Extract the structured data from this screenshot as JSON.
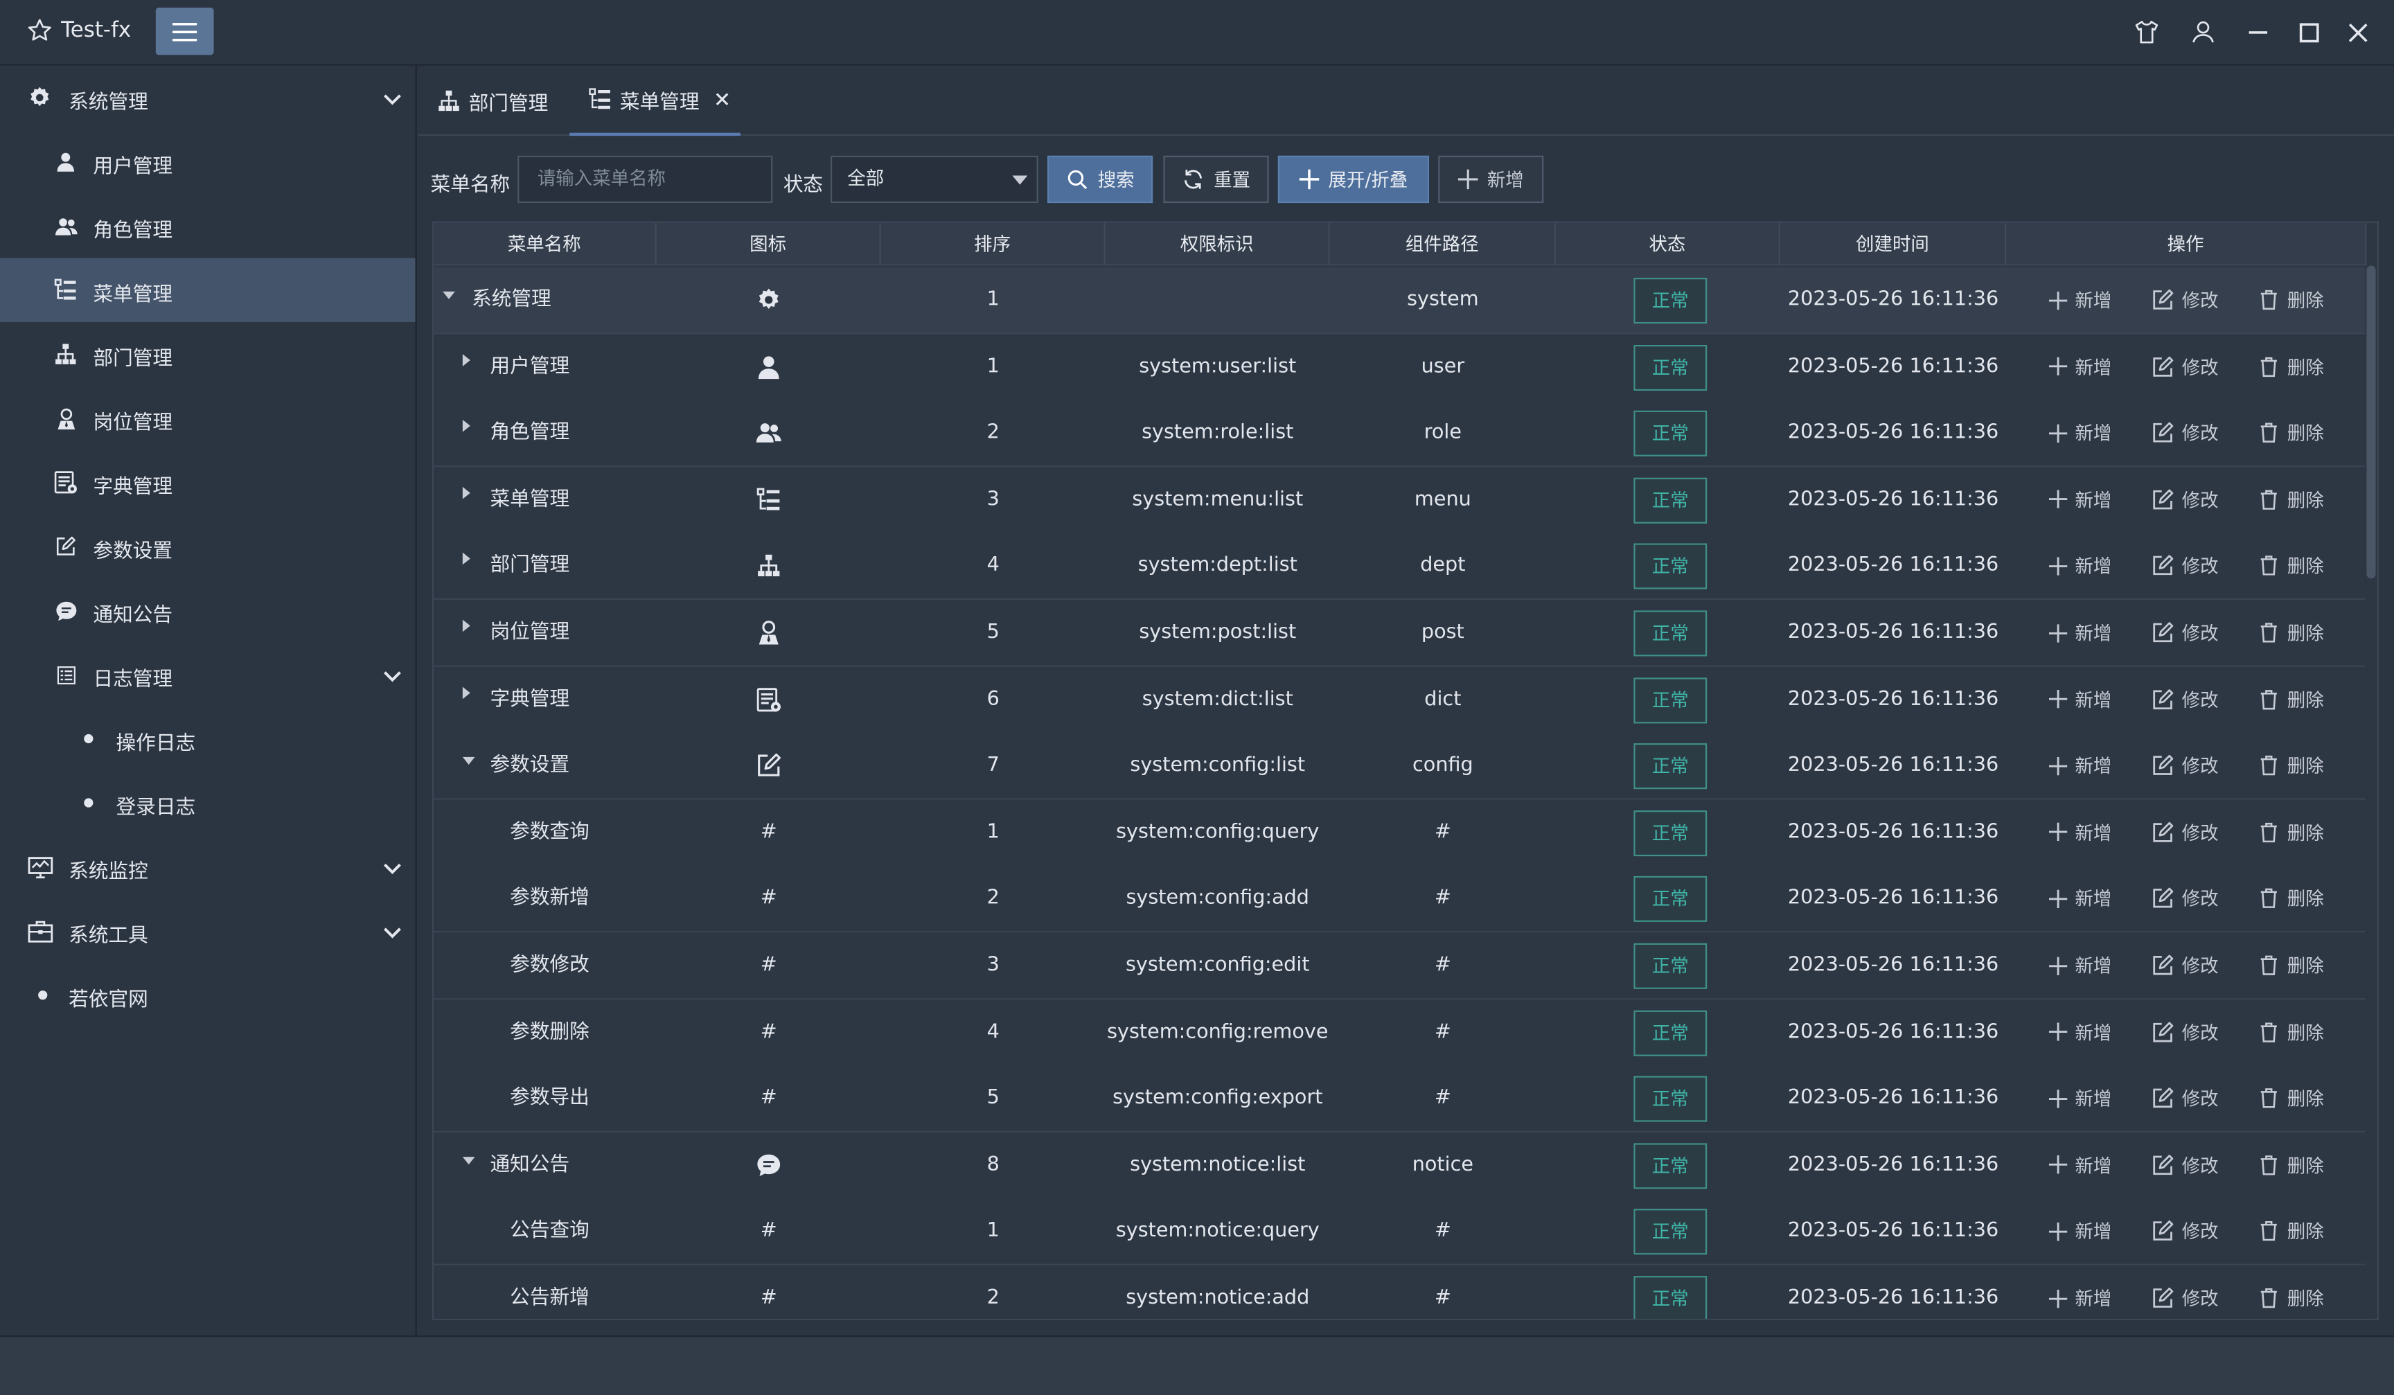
{
  "window": {
    "title": "Test-fx"
  },
  "sidebar": {
    "items": [
      {
        "label": "系统管理",
        "icon": "gear-icon"
      },
      {
        "label": "用户管理",
        "icon": "user-icon"
      },
      {
        "label": "角色管理",
        "icon": "users-icon"
      },
      {
        "label": "菜单管理",
        "icon": "menu-tree-icon"
      },
      {
        "label": "部门管理",
        "icon": "org-chart-icon"
      },
      {
        "label": "岗位管理",
        "icon": "post-icon"
      },
      {
        "label": "字典管理",
        "icon": "dict-icon"
      },
      {
        "label": "参数设置",
        "icon": "edit-icon"
      },
      {
        "label": "通知公告",
        "icon": "chat-icon"
      },
      {
        "label": "日志管理",
        "icon": "log-icon"
      },
      {
        "label": "操作日志",
        "icon": "dot-icon"
      },
      {
        "label": "登录日志",
        "icon": "dot-icon"
      },
      {
        "label": "系统监控",
        "icon": "monitor-icon"
      },
      {
        "label": "系统工具",
        "icon": "toolbox-icon"
      },
      {
        "label": "若依官网",
        "icon": "dot-icon"
      }
    ]
  },
  "tabs": [
    {
      "label": "部门管理"
    },
    {
      "label": "菜单管理"
    }
  ],
  "search": {
    "name_label": "菜单名称",
    "name_placeholder": "请输入菜单名称",
    "status_label": "状态",
    "status_value": "全部",
    "search_btn": "搜索",
    "reset_btn": "重置",
    "expand_btn": "展开/折叠",
    "add_btn": "新增"
  },
  "table": {
    "columns": [
      "菜单名称",
      "图标",
      "排序",
      "权限标识",
      "组件路径",
      "状态",
      "创建时间",
      "操作"
    ],
    "actions": {
      "add": "新增",
      "edit": "修改",
      "delete": "删除"
    },
    "rows": [
      {
        "name": "系统管理",
        "icon": "gear-icon",
        "order": "1",
        "perm": "",
        "path": "system",
        "status": "正常",
        "created": "2023-05-26 16:11:36"
      },
      {
        "name": "用户管理",
        "icon": "user-icon",
        "order": "1",
        "perm": "system:user:list",
        "path": "user",
        "status": "正常",
        "created": "2023-05-26 16:11:36"
      },
      {
        "name": "角色管理",
        "icon": "users-icon",
        "order": "2",
        "perm": "system:role:list",
        "path": "role",
        "status": "正常",
        "created": "2023-05-26 16:11:36"
      },
      {
        "name": "菜单管理",
        "icon": "menu-tree-icon",
        "order": "3",
        "perm": "system:menu:list",
        "path": "menu",
        "status": "正常",
        "created": "2023-05-26 16:11:36"
      },
      {
        "name": "部门管理",
        "icon": "org-chart-icon",
        "order": "4",
        "perm": "system:dept:list",
        "path": "dept",
        "status": "正常",
        "created": "2023-05-26 16:11:36"
      },
      {
        "name": "岗位管理",
        "icon": "post-icon",
        "order": "5",
        "perm": "system:post:list",
        "path": "post",
        "status": "正常",
        "created": "2023-05-26 16:11:36"
      },
      {
        "name": "字典管理",
        "icon": "dict-icon",
        "order": "6",
        "perm": "system:dict:list",
        "path": "dict",
        "status": "正常",
        "created": "2023-05-26 16:11:36"
      },
      {
        "name": "参数设置",
        "icon": "edit-icon",
        "order": "7",
        "perm": "system:config:list",
        "path": "config",
        "status": "正常",
        "created": "2023-05-26 16:11:36"
      },
      {
        "name": "参数查询",
        "icon": "#",
        "order": "1",
        "perm": "system:config:query",
        "path": "#",
        "status": "正常",
        "created": "2023-05-26 16:11:36"
      },
      {
        "name": "参数新增",
        "icon": "#",
        "order": "2",
        "perm": "system:config:add",
        "path": "#",
        "status": "正常",
        "created": "2023-05-26 16:11:36"
      },
      {
        "name": "参数修改",
        "icon": "#",
        "order": "3",
        "perm": "system:config:edit",
        "path": "#",
        "status": "正常",
        "created": "2023-05-26 16:11:36"
      },
      {
        "name": "参数删除",
        "icon": "#",
        "order": "4",
        "perm": "system:config:remove",
        "path": "#",
        "status": "正常",
        "created": "2023-05-26 16:11:36"
      },
      {
        "name": "参数导出",
        "icon": "#",
        "order": "5",
        "perm": "system:config:export",
        "path": "#",
        "status": "正常",
        "created": "2023-05-26 16:11:36"
      },
      {
        "name": "通知公告",
        "icon": "chat-icon",
        "order": "8",
        "perm": "system:notice:list",
        "path": "notice",
        "status": "正常",
        "created": "2023-05-26 16:11:36"
      },
      {
        "name": "公告查询",
        "icon": "#",
        "order": "1",
        "perm": "system:notice:query",
        "path": "#",
        "status": "正常",
        "created": "2023-05-26 16:11:36"
      },
      {
        "name": "公告新增",
        "icon": "#",
        "order": "2",
        "perm": "system:notice:add",
        "path": "#",
        "status": "正常",
        "created": "2023-05-26 16:11:36"
      }
    ]
  },
  "colors": {
    "accent": "#5a7596",
    "primary_button": "#4e6f9c",
    "status_badge": "#3fb3a6",
    "active_sidebar": "#44546a"
  }
}
